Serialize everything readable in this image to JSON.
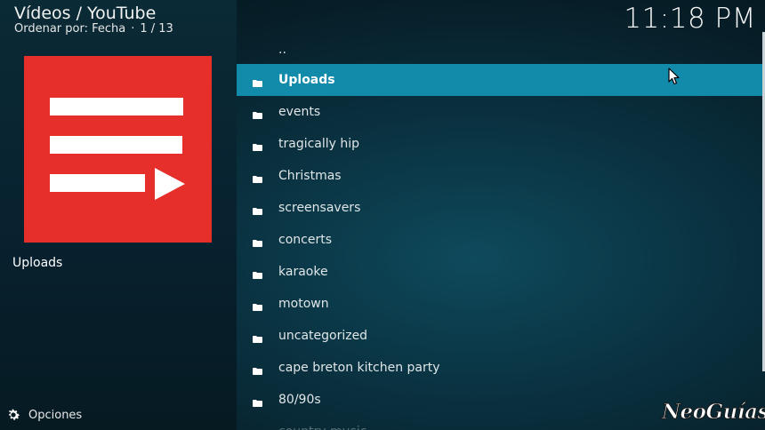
{
  "header": {
    "title": "Vídeos / YouTube",
    "sort_label": "Ordenar por: Fecha",
    "sort_separator": "·",
    "position": "1 / 13"
  },
  "clock": "11:18 PM",
  "thumbnail": {
    "icon": "youtube-playlist-icon",
    "background_color": "#e62e2b"
  },
  "selected_item_label": "Uploads",
  "options": {
    "label": "Opciones",
    "icon": "gear-icon"
  },
  "list": {
    "parent_label": "..",
    "items": [
      "Uploads",
      "events",
      "tragically hip",
      "Christmas",
      "screensavers",
      "concerts",
      "karaoke",
      "motown",
      "uncategorized",
      "cape breton kitchen party",
      "80/90s",
      "country music"
    ],
    "selected_index": 0,
    "item_icon": "folder-icon",
    "highlight_color": "#128bab"
  },
  "watermark": "NeoGuías"
}
